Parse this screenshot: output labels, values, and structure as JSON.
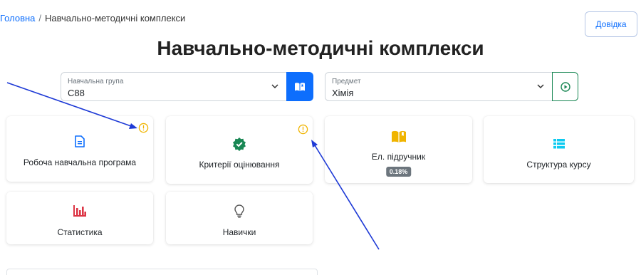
{
  "breadcrumb": {
    "home": "Головна",
    "separator": "/",
    "current": "Навчально-методичні комплекси"
  },
  "header": {
    "help_label": "Довідка"
  },
  "title": "Навчально-методичні комплекси",
  "filters": {
    "group": {
      "label": "Навчальна група",
      "value": "С88"
    },
    "subject": {
      "label": "Предмет",
      "value": "Хімія"
    }
  },
  "cards": {
    "program": {
      "label": "Робоча навчальна програма",
      "icon": "document-icon",
      "warning": true
    },
    "criteria": {
      "label": "Критерії оцінювання",
      "icon": "verified-badge-icon",
      "warning": true
    },
    "textbook": {
      "label": "Ел. підручник",
      "icon": "open-book-icon",
      "badge": "0.18%"
    },
    "structure": {
      "label": "Структура курсу",
      "icon": "list-icon"
    },
    "stats": {
      "label": "Статистика",
      "icon": "bar-chart-icon"
    },
    "skills": {
      "label": "Навички",
      "icon": "lightbulb-icon"
    }
  },
  "colors": {
    "primary": "#0d6efd",
    "success": "#198754",
    "warning": "#f0b400",
    "danger": "#dc3545",
    "info": "#0dcaf0",
    "annotation": "#1e3ad6"
  }
}
